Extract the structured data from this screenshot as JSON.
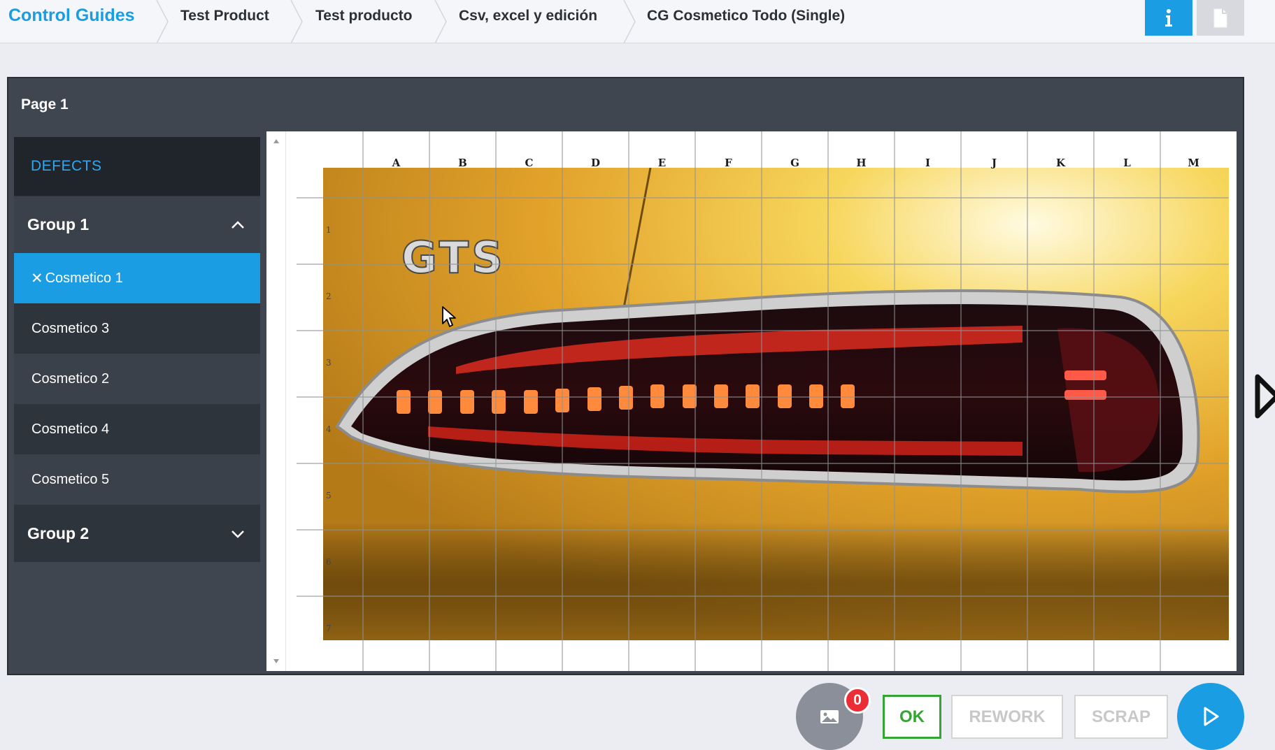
{
  "breadcrumb": {
    "app": "Control Guides",
    "items": [
      "Test Product",
      "Test producto",
      "Csv, excel y edición",
      "CG Cosmetico Todo (Single)"
    ]
  },
  "top_actions": {
    "info_icon": "info-icon",
    "document_icon": "document-icon"
  },
  "page": {
    "title": "Page 1"
  },
  "sidebar": {
    "header": "DEFECTS",
    "groups": [
      {
        "label": "Group 1",
        "expanded": true,
        "items": [
          {
            "label": "Cosmetico 1",
            "selected": true,
            "marker": "✕"
          },
          {
            "label": "Cosmetico 3",
            "selected": false
          },
          {
            "label": "Cosmetico 2",
            "selected": false
          },
          {
            "label": "Cosmetico 4",
            "selected": false
          },
          {
            "label": "Cosmetico 5",
            "selected": false
          }
        ]
      },
      {
        "label": "Group 2",
        "expanded": false
      }
    ]
  },
  "grid": {
    "columns": [
      "A",
      "B",
      "C",
      "D",
      "E",
      "F",
      "G",
      "H",
      "I",
      "J",
      "K",
      "L",
      "M"
    ],
    "rows": [
      "1",
      "2",
      "3",
      "4",
      "5",
      "6",
      "7"
    ],
    "image": "car-taillight-photo"
  },
  "footer": {
    "gallery_count": "0",
    "ok_label": "OK",
    "rework_label": "REWORK",
    "scrap_label": "SCRAP"
  },
  "colors": {
    "accent": "#1a9de2",
    "ok": "#34a534",
    "badge": "#ec2d36",
    "panel": "#3f4650"
  }
}
